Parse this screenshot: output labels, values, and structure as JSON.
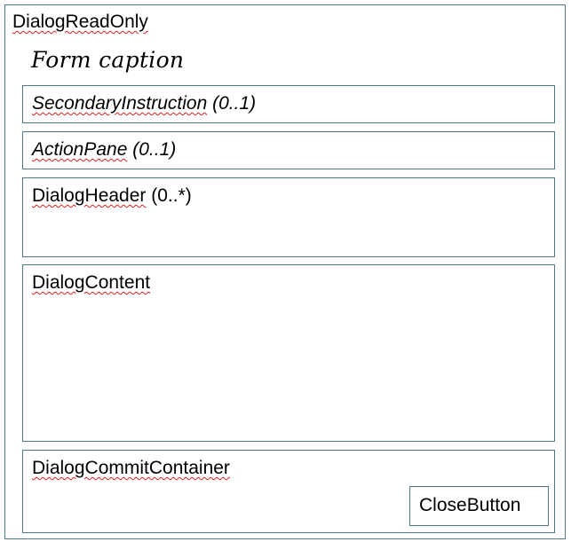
{
  "dialog": {
    "name": "DialogReadOnly",
    "caption": "Form caption",
    "sections": {
      "secondary_instruction": {
        "name": "SecondaryInstruction",
        "multiplicity": " (0..1)"
      },
      "action_pane": {
        "name": "ActionPane",
        "multiplicity": " (0..1)"
      },
      "dialog_header": {
        "name": "DialogHeader",
        "multiplicity": " (0..*)"
      },
      "dialog_content": {
        "name": "DialogContent"
      },
      "dialog_commit_container": {
        "name": "DialogCommitContainer",
        "close_button": "CloseButton"
      }
    }
  },
  "colors": {
    "border": "#4f7a8c",
    "spellcheck_underline": "#e02020"
  }
}
